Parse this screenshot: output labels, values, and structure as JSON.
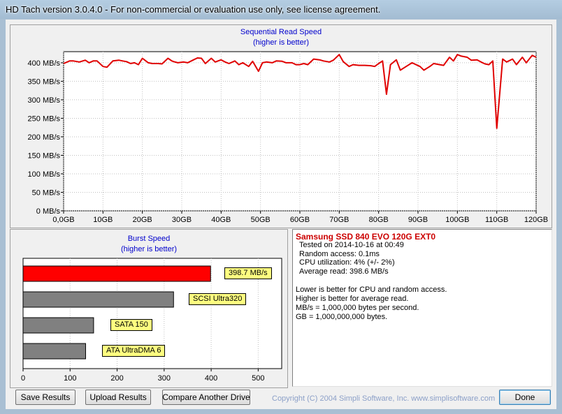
{
  "window": {
    "title": "HD Tach version 3.0.4.0  - For non-commercial or evaluation use only, see license agreement."
  },
  "read_chart": {
    "title": "Sequential Read Speed",
    "subtitle": "(higher is better)",
    "y_ticks": [
      "400 MB/s",
      "350 MB/s",
      "300 MB/s",
      "250 MB/s",
      "200 MB/s",
      "150 MB/s",
      "100 MB/s",
      "50 MB/s",
      "0 MB/s"
    ],
    "x_ticks": [
      "0,0GB",
      "10GB",
      "20GB",
      "30GB",
      "40GB",
      "50GB",
      "60GB",
      "70GB",
      "80GB",
      "90GB",
      "100GB",
      "110GB",
      "120GB"
    ],
    "line_color": "#e00000"
  },
  "burst_chart": {
    "title": "Burst Speed",
    "subtitle": "(higher is better)",
    "x_ticks": [
      "0",
      "100",
      "200",
      "300",
      "400",
      "500"
    ]
  },
  "chart_data": [
    {
      "type": "line",
      "title": "Sequential Read Speed",
      "subtitle": "(higher is better)",
      "xlabel": "",
      "ylabel": "",
      "xlim": [
        0,
        120
      ],
      "ylim": [
        0,
        430
      ],
      "x_unit": "GB",
      "y_unit": "MB/s",
      "grid": true,
      "series": [
        {
          "color": "#e00000",
          "x": [
            0,
            1.5,
            2.5,
            4,
            5.5,
            6.5,
            7.5,
            8.5,
            10,
            11,
            12.5,
            14,
            15,
            16,
            17,
            18,
            19,
            20,
            21.5,
            22.5,
            24,
            25,
            26.5,
            27.5,
            28,
            29,
            30.5,
            31.5,
            33,
            34,
            35,
            36,
            37.5,
            38.5,
            40,
            41,
            42,
            43.5,
            44.5,
            45.5,
            47,
            48,
            49.5,
            50.5,
            51.5,
            53,
            54,
            55.5,
            56.5,
            58,
            59,
            60,
            61,
            62,
            63.5,
            65,
            66,
            67.5,
            68.5,
            70,
            71,
            72.5,
            73.5,
            75,
            76.5,
            78,
            79,
            80,
            81,
            82,
            83,
            84.5,
            85.5,
            87,
            88.5,
            89.5,
            90.5,
            91.5,
            93,
            94,
            95.5,
            96.5,
            98,
            99,
            100,
            101,
            102.5,
            103.5,
            105,
            106,
            107,
            108,
            109,
            110,
            111.5,
            112.5,
            114,
            115,
            116.5,
            117.5,
            119,
            120
          ],
          "y": [
            398,
            405,
            405,
            402,
            407,
            400,
            405,
            405,
            390,
            388,
            405,
            407,
            405,
            403,
            398,
            400,
            395,
            412,
            400,
            398,
            398,
            397,
            412,
            405,
            403,
            400,
            402,
            400,
            408,
            413,
            412,
            398,
            412,
            402,
            408,
            402,
            398,
            405,
            395,
            400,
            390,
            404,
            377,
            400,
            402,
            400,
            405,
            404,
            400,
            400,
            395,
            395,
            398,
            395,
            410,
            408,
            405,
            402,
            407,
            422,
            403,
            390,
            395,
            393,
            393,
            392,
            390,
            398,
            405,
            315,
            395,
            408,
            380,
            390,
            400,
            395,
            390,
            380,
            390,
            398,
            395,
            393,
            415,
            405,
            422,
            418,
            415,
            407,
            408,
            402,
            397,
            395,
            405,
            223,
            410,
            402,
            410,
            395,
            415,
            400,
            420,
            415
          ]
        }
      ]
    },
    {
      "type": "bar",
      "orientation": "horizontal",
      "title": "Burst Speed",
      "subtitle": "(higher is better)",
      "xlim": [
        0,
        550
      ],
      "categories": [
        "398.7 MB/s",
        "SCSI Ultra320",
        "SATA 150",
        "ATA UltraDMA 6"
      ],
      "values": [
        398.7,
        320,
        150,
        133
      ],
      "colors": [
        "#ff0000",
        "#808080",
        "#808080",
        "#808080"
      ]
    }
  ],
  "info": {
    "drive": "Samsung SSD 840 EVO 120G EXT0",
    "lines": [
      "Tested on 2014-10-16 at 00:49",
      "Random access: 0.1ms",
      "CPU utilization: 4% (+/- 2%)",
      "Average read: 398.6 MB/s"
    ],
    "notes": [
      "Lower is better for CPU and random access.",
      "Higher is better for average read.",
      "MB/s = 1,000,000 bytes per second.",
      "GB = 1,000,000,000 bytes."
    ]
  },
  "buttons": {
    "save": "Save Results",
    "upload": "Upload Results",
    "compare": "Compare Another Drive",
    "done": "Done"
  },
  "copyright": "Copyright (C) 2004 Simpli Software, Inc. www.simplisoftware.com"
}
